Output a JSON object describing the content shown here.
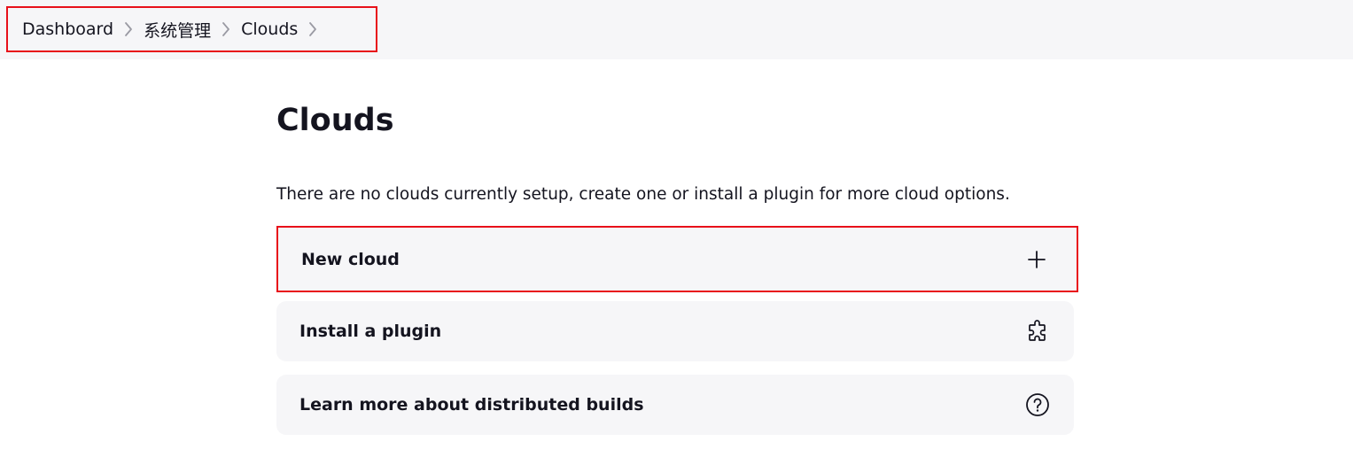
{
  "breadcrumb": {
    "items": [
      {
        "label": "Dashboard"
      },
      {
        "label": "系统管理"
      },
      {
        "label": "Clouds"
      }
    ]
  },
  "page": {
    "title": "Clouds",
    "description": "There are no clouds currently setup, create one or install a plugin for more cloud options."
  },
  "actions": [
    {
      "label": "New cloud",
      "icon": "plus-icon"
    },
    {
      "label": "Install a plugin",
      "icon": "puzzle-icon"
    },
    {
      "label": "Learn more about distributed builds",
      "icon": "help-circle-icon"
    }
  ],
  "colors": {
    "highlight": "#e8101a",
    "card_background": "#f6f6f8",
    "text": "#14141f"
  }
}
